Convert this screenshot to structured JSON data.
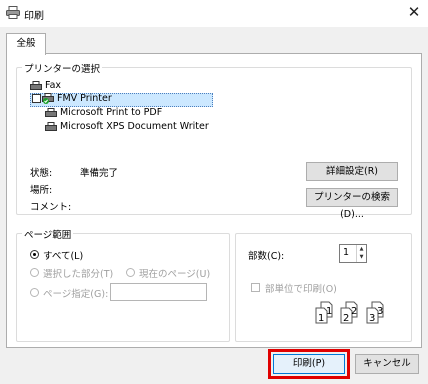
{
  "window": {
    "title": "印刷",
    "close_symbol": "✕"
  },
  "tabs": [
    {
      "label": "全般"
    }
  ],
  "printer_group": {
    "legend": "プリンターの選択",
    "printers": [
      {
        "name": "Fax"
      },
      {
        "name": "FMV Printer",
        "selected": true,
        "default": true
      },
      {
        "name": "Microsoft Print to PDF"
      },
      {
        "name": "Microsoft XPS Document Writer"
      }
    ],
    "status_label": "状態:",
    "status_value": "準備完了",
    "location_label": "場所:",
    "comment_label": "コメント:",
    "details_button": "詳細設定(R)",
    "find_button": "プリンターの検索(D)..."
  },
  "page_range": {
    "legend": "ページ範囲",
    "all": "すべて(L)",
    "selection": "選択した部分(T)",
    "current_page": "現在のページ(U)",
    "pages": "ページ指定(G):"
  },
  "copies": {
    "label": "部数(C):",
    "value": "1",
    "collate": "部単位で印刷(O)"
  },
  "footer": {
    "print_button": "印刷(P)",
    "cancel_button": "キャンセル"
  }
}
